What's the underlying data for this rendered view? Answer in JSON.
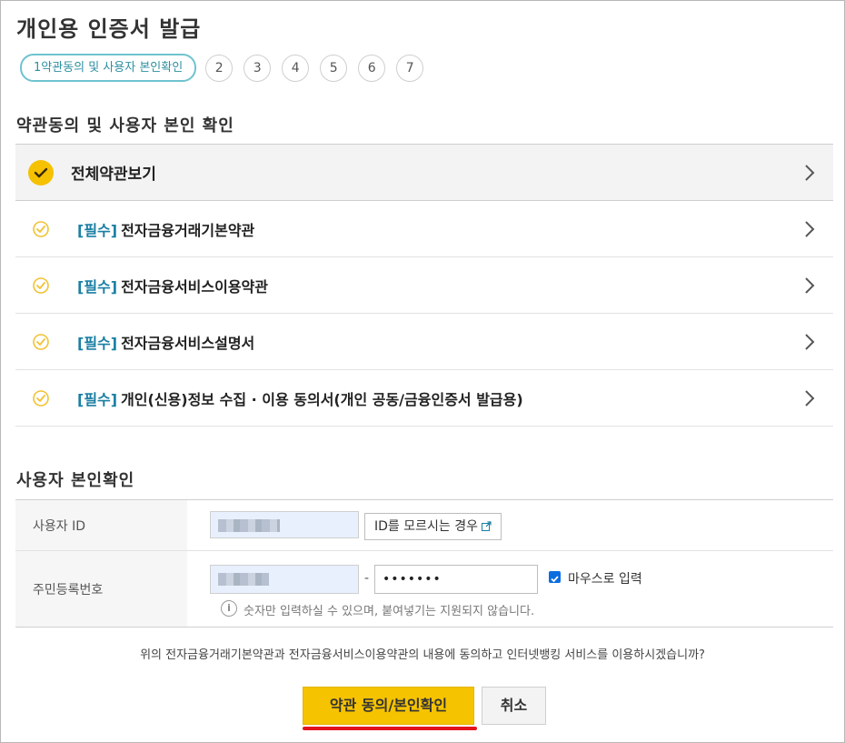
{
  "page": {
    "title": "개인용 인증서 발급"
  },
  "steps": {
    "active_label": "1약관동의 및 사용자 본인확인",
    "others": [
      "2",
      "3",
      "4",
      "5",
      "6",
      "7"
    ]
  },
  "agreement": {
    "section_title": "약관동의 및 사용자 본인 확인",
    "all_label": "전체약관보기",
    "items": [
      {
        "tag": "[필수]",
        "label": "전자금융거래기본약관"
      },
      {
        "tag": "[필수]",
        "label": "전자금융서비스이용약관"
      },
      {
        "tag": "[필수]",
        "label": "전자금융서비스설명서"
      },
      {
        "tag": "[필수]",
        "label": "개인(신용)정보 수집 · 이용 동의서(개인 공동/금융인증서 발급용)"
      }
    ]
  },
  "identity": {
    "section_title": "사용자 본인확인",
    "user_id_label": "사용자 ID",
    "forgot_id_button": "ID를 모르시는 경우",
    "rrn_label": "주민등록번호",
    "rrn_separator": "-",
    "rrn_back_value": "•••••••",
    "mouse_input_label": "마우스로 입력",
    "mouse_input_checked": true,
    "hint_icon": "i",
    "hint": "숫자만 입력하실 수 있으며, 붙여넣기는 지원되지 않습니다."
  },
  "footer": {
    "confirm_text": "위의 전자금융거래기본약관과 전자금융서비스이용약관의 내용에 동의하고 인터넷뱅킹 서비스를 이용하시겠습니까?",
    "agree_button": "약관 동의/본인확인",
    "cancel_button": "취소"
  },
  "colors": {
    "accent_yellow": "#f6c300",
    "step_teal": "#6fc3cf",
    "required_blue": "#1a7fa3",
    "highlight_red": "#e3131e"
  }
}
